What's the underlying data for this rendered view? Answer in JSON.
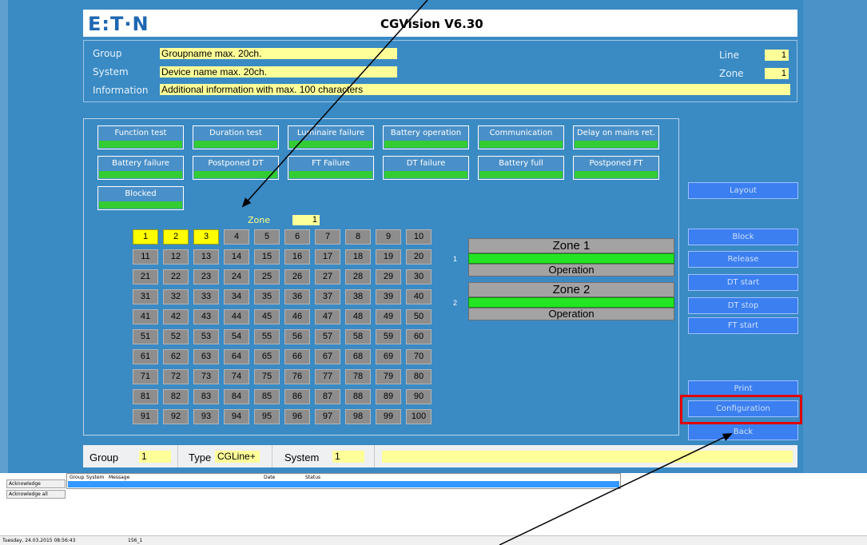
{
  "header": {
    "logo": "E:T·N",
    "title": "CGVision V6.30"
  },
  "info": {
    "group_label": "Group",
    "group_value": "Groupname max. 20ch.",
    "system_label": "System",
    "system_value": "Device name max. 20ch.",
    "info_label": "Information",
    "info_value": "Additional information with max. 100 characters",
    "line_label": "Line",
    "line_value": "1",
    "zone_label": "Zone",
    "zone_value": "1"
  },
  "status_boxes": [
    "Function test",
    "Duration test",
    "Luminaire failure",
    "Battery operation",
    "Communication",
    "Delay on mains ret.",
    "Battery failure",
    "Postponed DT",
    "FT Failure",
    "DT failure",
    "Battery full",
    "Postponed FT",
    "Blocked"
  ],
  "grid": {
    "zone_label": "Zone",
    "zone_value": "1",
    "selected": [
      1,
      2,
      3
    ],
    "cells": [
      "1",
      "2",
      "3",
      "4",
      "5",
      "6",
      "7",
      "8",
      "9",
      "10",
      "11",
      "12",
      "13",
      "14",
      "15",
      "16",
      "17",
      "18",
      "19",
      "20",
      "21",
      "22",
      "23",
      "24",
      "25",
      "26",
      "27",
      "28",
      "29",
      "30",
      "31",
      "32",
      "33",
      "34",
      "35",
      "36",
      "37",
      "38",
      "39",
      "40",
      "41",
      "42",
      "43",
      "44",
      "45",
      "46",
      "47",
      "48",
      "49",
      "50",
      "51",
      "52",
      "53",
      "54",
      "55",
      "56",
      "57",
      "58",
      "59",
      "60",
      "61",
      "62",
      "63",
      "64",
      "65",
      "66",
      "67",
      "68",
      "69",
      "70",
      "71",
      "72",
      "73",
      "74",
      "75",
      "76",
      "77",
      "78",
      "79",
      "80",
      "81",
      "82",
      "83",
      "84",
      "85",
      "86",
      "87",
      "88",
      "89",
      "90",
      "91",
      "92",
      "93",
      "94",
      "95",
      "96",
      "97",
      "98",
      "99",
      "100"
    ]
  },
  "zones": [
    {
      "num": "1",
      "name": "Zone 1",
      "state": "Operation"
    },
    {
      "num": "2",
      "name": "Zone 2",
      "state": "Operation"
    }
  ],
  "buttons": {
    "layout": "Layout",
    "block": "Block",
    "release": "Release",
    "dt_start": "DT start",
    "dt_stop": "DT stop",
    "ft_start": "FT start",
    "print": "Print",
    "configuration": "Configuration",
    "back": "Back"
  },
  "bottom": {
    "group_label": "Group",
    "group_value": "1",
    "type_label": "Type",
    "type_value": "CGLine+",
    "system_label": "System",
    "system_value": "1"
  },
  "log": {
    "acknowledge": "Acknowledge",
    "acknowledge_all": "Acknowledge all",
    "columns": [
      "Group",
      "System",
      "Message",
      "Date",
      "Status"
    ]
  },
  "statusbar": {
    "datetime": "Tuesday, 24.03.2015 08:56:43",
    "info": "156_1"
  },
  "colors": {
    "highlight": "#e00000",
    "ok_bar": "#33cc33",
    "selected_cell": "#ffff00"
  }
}
